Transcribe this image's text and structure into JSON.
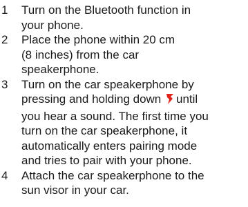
{
  "steps": [
    {
      "number": "1",
      "lines": [
        "Turn on the Bluetooth function in",
        "your phone."
      ]
    },
    {
      "number": "2",
      "lines": [
        "Place the phone within 20 cm",
        "(8 inches) from the car",
        "speakerphone."
      ]
    },
    {
      "number": "3",
      "line1": "Turn on the car speakerphone by",
      "line2_before": "pressing and holding down",
      "line2_after": "until",
      "line2_icon": "power-key-icon",
      "line3": "you hear a sound. The first time you",
      "line4": "turn on the car speakerphone, it",
      "line5": "automatically enters pairing mode",
      "line6": "and tries to pair with your phone."
    },
    {
      "number": "4",
      "lines": [
        "Attach the car speakerphone to the",
        "sun visor in your car."
      ]
    }
  ],
  "colors": {
    "text": "#1a1a1a",
    "icon_red": "#e2231a"
  }
}
